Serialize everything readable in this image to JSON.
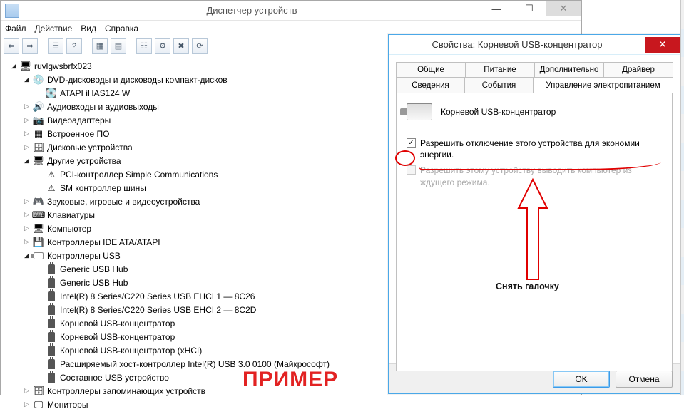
{
  "dm": {
    "title": "Диспетчер устройств",
    "menu": {
      "file": "Файл",
      "action": "Действие",
      "view": "Вид",
      "help": "Справка"
    },
    "root": "ruvlgwsbrfx023",
    "nodes": {
      "dvd": "DVD-дисководы и дисководы компакт-дисков",
      "dvd_child": "ATAPI iHAS124   W",
      "audio": "Аудиовходы и аудиовыходы",
      "video": "Видеоадаптеры",
      "firmware": "Встроенное ПО",
      "disks": "Дисковые устройства",
      "other": "Другие устройства",
      "other_pci": "PCI-контроллер Simple Communications",
      "other_sm": "SM контроллер шины",
      "sound": "Звуковые, игровые и видеоустройства",
      "keyboards": "Клавиатуры",
      "computer": "Компьютер",
      "ide": "Контроллеры IDE ATA/ATAPI",
      "usb": "Контроллеры USB",
      "usb_items": [
        "Generic USB Hub",
        "Generic USB Hub",
        "Intel(R) 8 Series/C220 Series USB EHCI 1 — 8C26",
        "Intel(R) 8 Series/C220 Series USB EHCI 2 — 8C2D",
        "Корневой USB-концентратор",
        "Корневой USB-концентратор",
        "Корневой USB-концентратор (xHCI)",
        "Расширяемый хост-контроллер Intel(R) USB 3.0 0100 (Майкрософт)",
        "Составное USB устройство"
      ],
      "storage": "Контроллеры запоминающих устройств",
      "monitors": "Мониторы"
    }
  },
  "props": {
    "title": "Свойства: Корневой USB-концентратор",
    "tabs_row1": [
      "Общие",
      "Питание",
      "Дополнительно",
      "Драйвер"
    ],
    "tabs_row2": [
      "Сведения",
      "События",
      "Управление электропитанием"
    ],
    "device_name": "Корневой USB-концентратор",
    "opt1": "Разрешить отключение этого устройства для экономии энергии.",
    "opt2": "Разрешить этому устройству выводить компьютер из ждущего режима.",
    "ok": "OK",
    "cancel": "Отмена"
  },
  "annot": {
    "hint": "Снять галочку",
    "example": "ПРИМЕР"
  }
}
